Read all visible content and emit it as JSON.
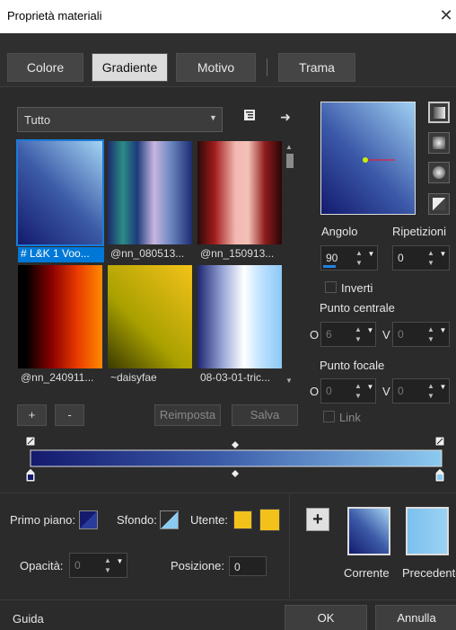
{
  "window": {
    "title": "Proprietà materiali",
    "close_glyph": "✕"
  },
  "tabs": [
    {
      "label": "Colore",
      "active": false
    },
    {
      "label": "Gradiente",
      "active": true
    },
    {
      "label": "Motivo",
      "active": false
    },
    {
      "label": "Trama",
      "active": false
    }
  ],
  "library": {
    "category": "Tutto",
    "items": [
      {
        "label": "# L&K 1 Voo...",
        "selected": true
      },
      {
        "label": "@nn_080513...",
        "selected": false
      },
      {
        "label": "@nn_150913...",
        "selected": false
      },
      {
        "label": "@nn_240911...",
        "selected": false
      },
      {
        "label": "~daisyfae",
        "selected": false
      },
      {
        "label": "08-03-01-tric...",
        "selected": false
      }
    ],
    "add_label": "+",
    "remove_label": "-",
    "reset_label": "Reimposta",
    "save_label": "Salva"
  },
  "settings": {
    "angle_label": "Angolo",
    "angle_value": "90",
    "repeats_label": "Ripetizioni",
    "repeats_value": "0",
    "invert_label": "Inverti",
    "center_label": "Punto centrale",
    "center_h_label": "O",
    "center_h_value": "6",
    "center_v_label": "V",
    "center_v_value": "0",
    "focal_label": "Punto focale",
    "focal_h_label": "O",
    "focal_h_value": "0",
    "focal_v_label": "V",
    "focal_v_value": "0",
    "link_label": "Link"
  },
  "bottom": {
    "foreground_label": "Primo piano:",
    "background_label": "Sfondo:",
    "user_label": "Utente:",
    "opacity_label": "Opacità:",
    "opacity_value": "0",
    "position_label": "Posizione:",
    "position_value": "0",
    "current_label": "Corrente",
    "previous_label": "Precedente",
    "add_glyph": "+"
  },
  "footer": {
    "help_label": "Guida",
    "ok_label": "OK",
    "cancel_label": "Annulla"
  },
  "colors": {
    "accent": "#0078d7",
    "gradient_start": "#141a6e",
    "gradient_end": "#9fd0f2",
    "user_color": "#f2c21b"
  }
}
